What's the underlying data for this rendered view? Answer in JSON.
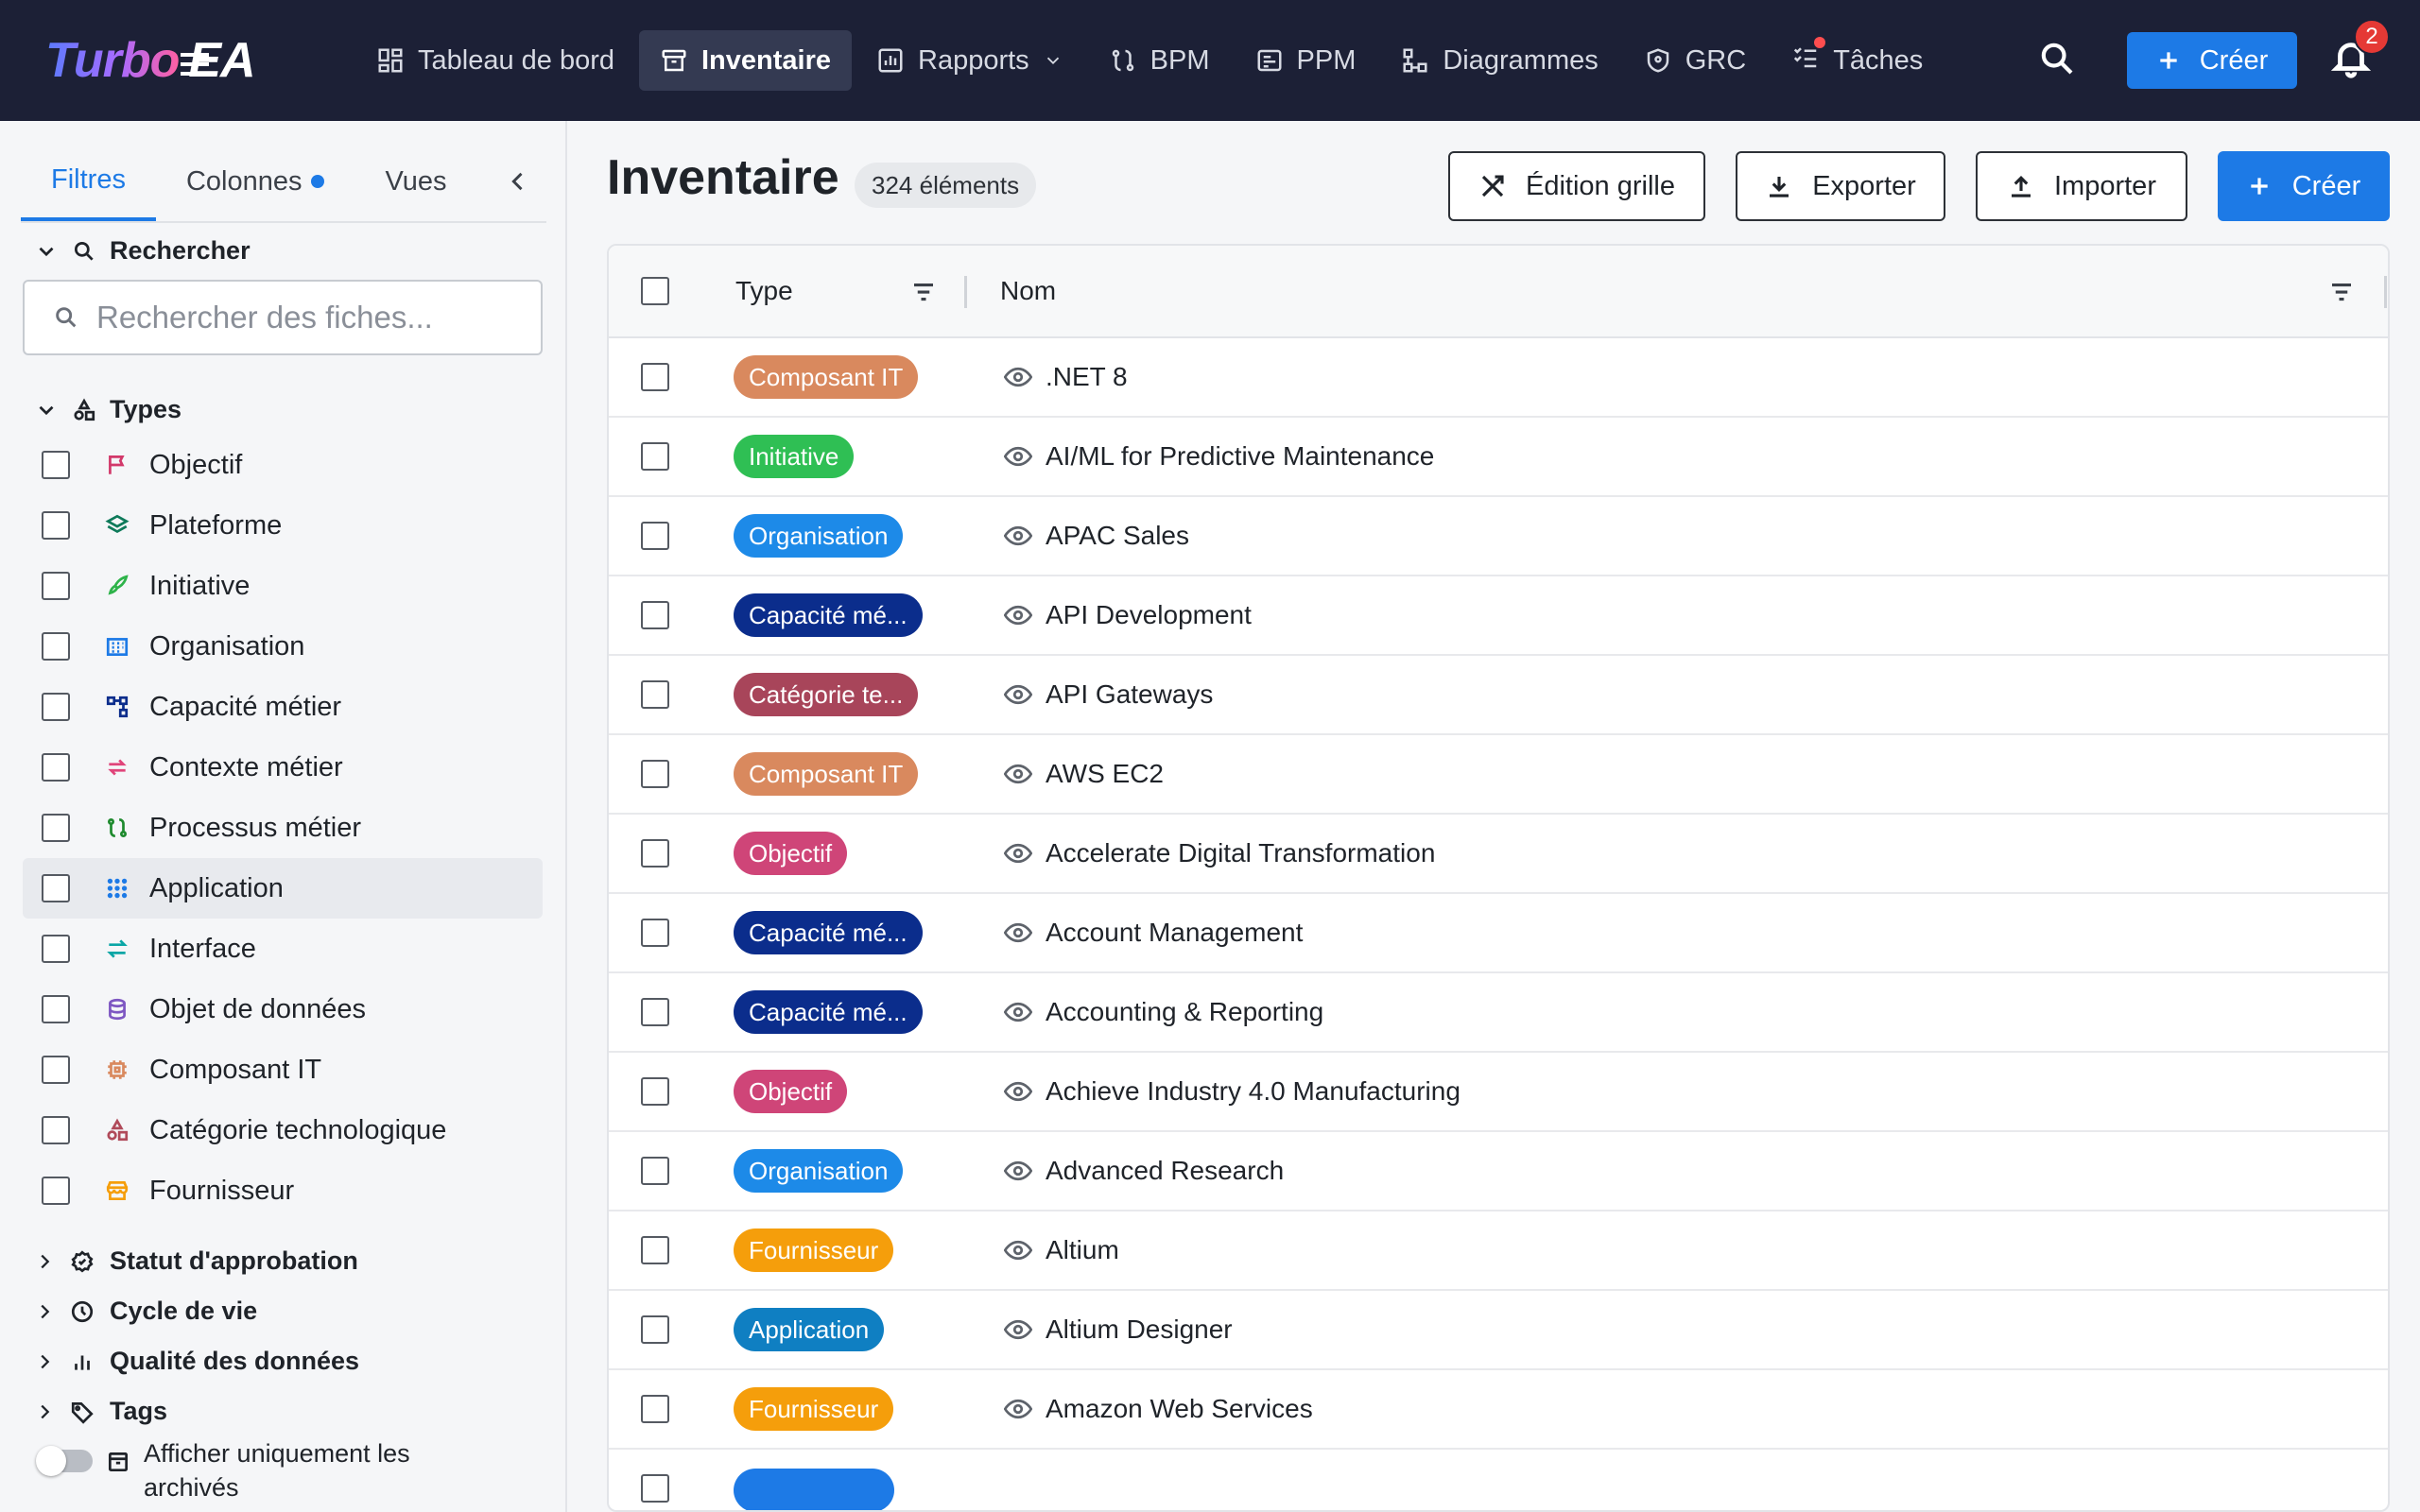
{
  "app": {
    "logo_turbo": "Turbo",
    "logo_ea": "EA",
    "nav": [
      {
        "label": "Tableau de bord",
        "icon": "dashboard-icon"
      },
      {
        "label": "Inventaire",
        "icon": "inventory-icon",
        "active": true
      },
      {
        "label": "Rapports",
        "icon": "report-icon",
        "dropdown": true
      },
      {
        "label": "BPM",
        "icon": "bpm-icon"
      },
      {
        "label": "PPM",
        "icon": "ppm-icon"
      },
      {
        "label": "Diagrammes",
        "icon": "diagram-icon"
      },
      {
        "label": "GRC",
        "icon": "shield-icon"
      },
      {
        "label": "Tâches",
        "icon": "tasks-icon"
      }
    ],
    "create_label": "Créer",
    "notification_count": "2"
  },
  "sidebar": {
    "tabs": [
      {
        "label": "Filtres",
        "active": true
      },
      {
        "label": "Colonnes",
        "dot": true
      },
      {
        "label": "Vues"
      }
    ],
    "search_section": "Rechercher",
    "search_placeholder": "Rechercher des fiches...",
    "types_section": "Types",
    "types": [
      {
        "label": "Objectif",
        "icon": "flag-icon",
        "color": "#d2386a"
      },
      {
        "label": "Plateforme",
        "icon": "layers-icon",
        "color": "#0e7a5a"
      },
      {
        "label": "Initiative",
        "icon": "rocket-icon",
        "color": "#2eb34a"
      },
      {
        "label": "Organisation",
        "icon": "building-icon",
        "color": "#1d7ae6"
      },
      {
        "label": "Capacité métier",
        "icon": "hierarchy-icon",
        "color": "#0b2d8c"
      },
      {
        "label": "Contexte métier",
        "icon": "swap-icon",
        "color": "#e0447a"
      },
      {
        "label": "Processus métier",
        "icon": "process-icon",
        "color": "#1e8a2e"
      },
      {
        "label": "Application",
        "icon": "apps-icon",
        "color": "#1d7ae6"
      },
      {
        "label": "Interface",
        "icon": "arrows-icon",
        "color": "#0aa6a6"
      },
      {
        "label": "Objet de données",
        "icon": "database-icon",
        "color": "#7e57c2"
      },
      {
        "label": "Composant IT",
        "icon": "chip-icon",
        "color": "#d9895e"
      },
      {
        "label": "Catégorie technologique",
        "icon": "category-icon",
        "color": "#b04a5a"
      },
      {
        "label": "Fournisseur",
        "icon": "store-icon",
        "color": "#f59e0b"
      }
    ],
    "collapsibles": [
      {
        "label": "Statut d'approbation",
        "icon": "approval-icon"
      },
      {
        "label": "Cycle de vie",
        "icon": "clock-icon"
      },
      {
        "label": "Qualité des données",
        "icon": "bar-chart-icon"
      },
      {
        "label": "Tags",
        "icon": "tag-icon"
      }
    ],
    "archive_label": "Afficher uniquement les archivés"
  },
  "main": {
    "title": "Inventaire",
    "count": "324 éléments",
    "buttons": {
      "grid_edit": "Édition grille",
      "export": "Exporter",
      "import": "Importer",
      "create": "Créer"
    },
    "columns": {
      "type": "Type",
      "name": "Nom"
    },
    "rows": [
      {
        "type": "Composant IT",
        "color": "#d9895e",
        "name": ".NET 8"
      },
      {
        "type": "Initiative",
        "color": "#2fbf54",
        "name": "AI/ML for Predictive Maintenance"
      },
      {
        "type": "Organisation",
        "color": "#1d8ae8",
        "name": "APAC Sales"
      },
      {
        "type": "Capacité mé...",
        "color": "#0b2d8c",
        "name": "API Development"
      },
      {
        "type": "Catégorie te...",
        "color": "#a8455a",
        "name": "API Gateways"
      },
      {
        "type": "Composant IT",
        "color": "#d9895e",
        "name": "AWS EC2"
      },
      {
        "type": "Objectif",
        "color": "#cf4578",
        "name": "Accelerate Digital Transformation"
      },
      {
        "type": "Capacité mé...",
        "color": "#0b2d8c",
        "name": "Account Management"
      },
      {
        "type": "Capacité mé...",
        "color": "#0b2d8c",
        "name": "Accounting & Reporting"
      },
      {
        "type": "Objectif",
        "color": "#cf4578",
        "name": "Achieve Industry 4.0 Manufacturing"
      },
      {
        "type": "Organisation",
        "color": "#1d8ae8",
        "name": "Advanced Research"
      },
      {
        "type": "Fournisseur",
        "color": "#f59e0b",
        "name": "Altium"
      },
      {
        "type": "Application",
        "color": "#0f7fc2",
        "name": "Altium Designer"
      },
      {
        "type": "Fournisseur",
        "color": "#f59e0b",
        "name": "Amazon Web Services"
      }
    ]
  }
}
